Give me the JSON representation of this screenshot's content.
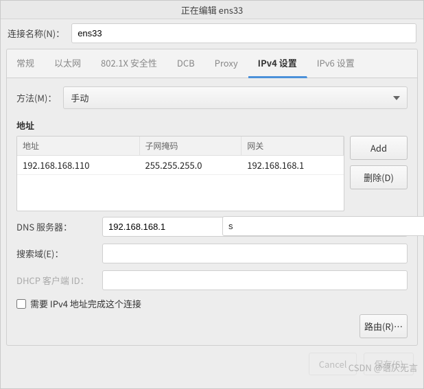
{
  "title": "正在编辑 ens33",
  "connection": {
    "label": "连接名称(N)：",
    "value": "ens33"
  },
  "tabs": {
    "items": [
      {
        "label": "常规"
      },
      {
        "label": "以太网"
      },
      {
        "label": "802.1X 安全性"
      },
      {
        "label": "DCB"
      },
      {
        "label": "Proxy"
      },
      {
        "label": "IPv4 设置"
      },
      {
        "label": "IPv6 设置"
      }
    ],
    "active_index": 5
  },
  "method": {
    "label": "方法(M)：",
    "value": "手动"
  },
  "addresses": {
    "section": "地址",
    "columns": [
      "地址",
      "子网掩码",
      "网关"
    ],
    "rows": [
      {
        "address": "192.168.168.110",
        "netmask": "255.255.255.0",
        "gateway": "192.168.168.1"
      }
    ],
    "add_label": "Add",
    "delete_label": "删除(D)"
  },
  "dns": {
    "label": "DNS 服务器：",
    "value": "192.168.168.1",
    "overlay_value": "s"
  },
  "search": {
    "label": "搜索域(E)：",
    "value": ""
  },
  "dhcp": {
    "label": "DHCP 客户端 ID：",
    "value": ""
  },
  "require": {
    "label": "需要 IPv4 地址完成这个连接",
    "checked": false
  },
  "routes": {
    "label": "路由(R)…"
  },
  "dialog": {
    "cancel": "Cancel",
    "save": "保存(S)"
  },
  "watermark": "CSDN @语仄无言"
}
